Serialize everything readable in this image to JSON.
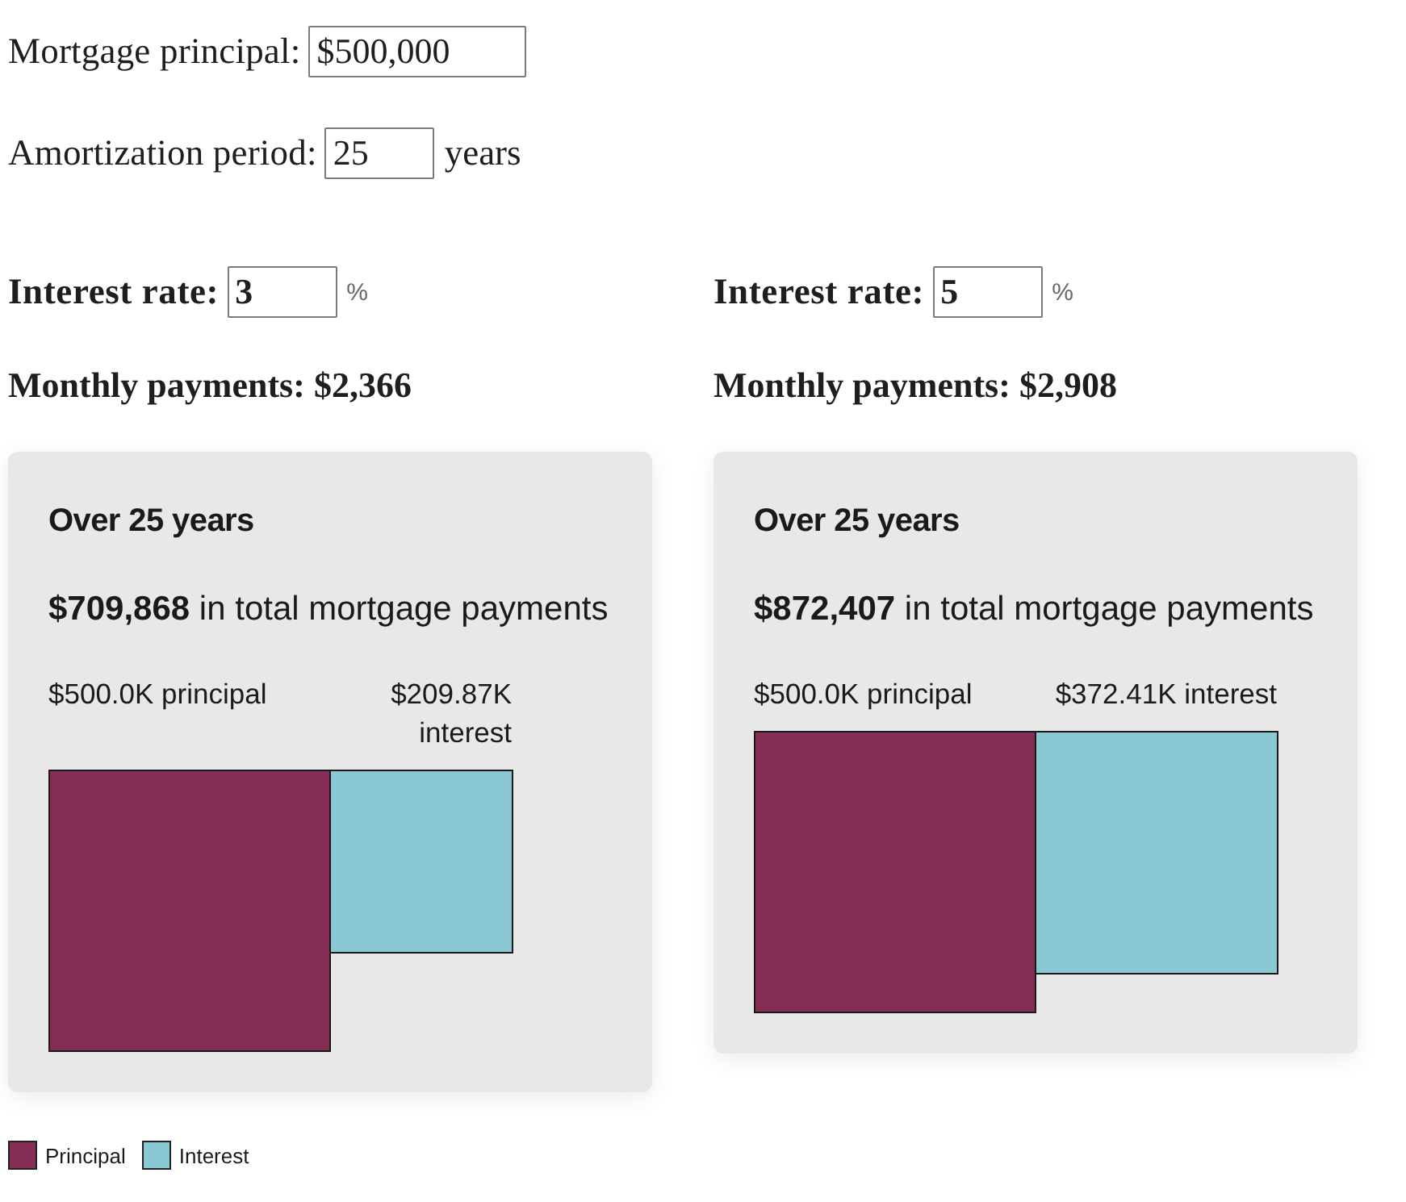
{
  "principal": {
    "label": "Mortgage principal:",
    "value": "$500,000"
  },
  "amortization": {
    "label": "Amortization period:",
    "value": "25",
    "unit": "years"
  },
  "scenarios": [
    {
      "rate": {
        "label": "Interest rate:",
        "value": "3",
        "unit": "%"
      },
      "monthly_payments": "Monthly payments: $2,366",
      "card": {
        "title": "Over 25 years",
        "total": "**$709,868** in total mortgage payments",
        "square_labels": [
          "$500.0K principal",
          "$209.87K interest"
        ]
      }
    },
    {
      "rate": {
        "label": "Interest rate:",
        "value": "5",
        "unit": "%"
      },
      "monthly_payments": "Monthly payments: $2,908",
      "card": {
        "title": "Over 25 years",
        "total": "**$872,407** in total mortgage payments",
        "square_labels": [
          "$500.0K principal",
          "$372.41K interest"
        ]
      }
    }
  ],
  "legend": [
    {
      "label": "Principal",
      "color": "#862d55"
    },
    {
      "label": "Interest",
      "color": "#8ac8d3"
    }
  ]
}
